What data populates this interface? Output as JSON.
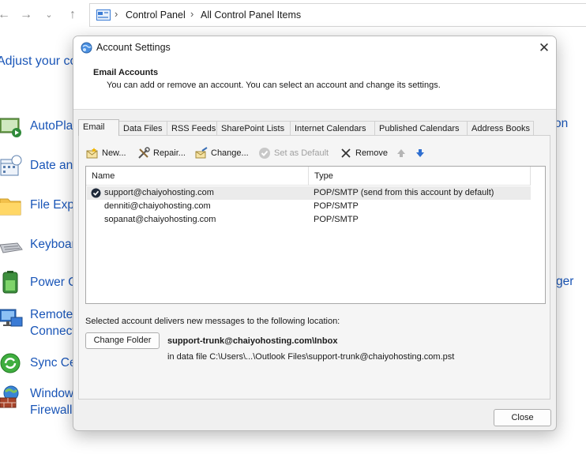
{
  "explorer": {
    "breadcrumb": [
      "Control Panel",
      "All Control Panel Items"
    ],
    "heading": "Adjust your co",
    "items": [
      {
        "label": "AutoPla"
      },
      {
        "label": "Date an"
      },
      {
        "label": "File Expl"
      },
      {
        "label": "Keyboar"
      },
      {
        "label": "Power O"
      },
      {
        "label": "Remote\nConnect"
      },
      {
        "label": "Sync Ce"
      },
      {
        "label": "Window\nFirewall"
      }
    ],
    "right_fragments": [
      "on",
      "ger"
    ]
  },
  "dialog": {
    "title": "Account Settings",
    "header_title": "Email Accounts",
    "header_desc": "You can add or remove an account. You can select an account and change its settings.",
    "tabs": [
      "Email",
      "Data Files",
      "RSS Feeds",
      "SharePoint Lists",
      "Internet Calendars",
      "Published Calendars",
      "Address Books"
    ],
    "active_tab": "Email",
    "toolbar": {
      "new": "New...",
      "repair": "Repair...",
      "change": "Change...",
      "set_default": "Set as Default",
      "remove": "Remove"
    },
    "columns": {
      "name": "Name",
      "type": "Type"
    },
    "accounts": [
      {
        "name": "support@chaiyohosting.com",
        "type": "POP/SMTP (send from this account by default)",
        "default": true
      },
      {
        "name": "denniti@chaiyohosting.com",
        "type": "POP/SMTP",
        "default": false
      },
      {
        "name": "sopanat@chaiyohosting.com",
        "type": "POP/SMTP",
        "default": false
      }
    ],
    "delivery_text": "Selected account delivers new messages to the following location:",
    "change_folder": "Change Folder",
    "location": "support-trunk@chaiyohosting.com\\Inbox",
    "data_file": "in data file C:\\Users\\...\\Outlook Files\\support-trunk@chaiyohosting.com.pst",
    "close_button": "Close"
  }
}
